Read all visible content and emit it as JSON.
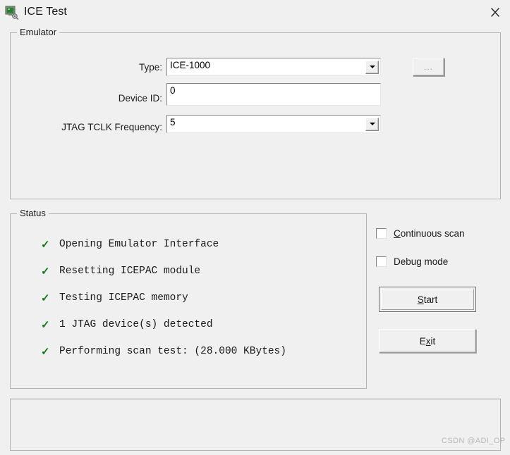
{
  "window": {
    "title": "ICE Test",
    "icon": "emulator-device-icon",
    "close_label": "✕"
  },
  "emulator": {
    "group_title": "Emulator",
    "type": {
      "label": "Type:",
      "value": "ICE-1000",
      "control": "combobox"
    },
    "device_id": {
      "label": "Device ID:",
      "value": "0",
      "placeholder": "",
      "control": "textbox"
    },
    "tclk": {
      "label": "JTAG TCLK Frequency:",
      "value": "5",
      "control": "combobox"
    },
    "browse_button": {
      "label": "...",
      "enabled": false
    }
  },
  "status": {
    "group_title": "Status",
    "check_glyph": "✓",
    "check_color": "#19781e",
    "items": [
      {
        "text": "Opening Emulator Interface",
        "done": true
      },
      {
        "text": "Resetting ICEPAC module",
        "done": true
      },
      {
        "text": "Testing ICEPAC memory",
        "done": true
      },
      {
        "text": "1 JTAG device(s) detected",
        "done": true
      },
      {
        "text": "Performing scan test: (28.000 KBytes)",
        "done": true
      }
    ]
  },
  "options": {
    "continuous_scan": {
      "label_accel": "C",
      "label_rest": "ontinuous scan",
      "checked": false
    },
    "debug_mode": {
      "label_accel": "D",
      "label_rest": "ebug mode",
      "checked": false
    }
  },
  "actions": {
    "start": {
      "accel": "S",
      "rest": "tart",
      "default": true
    },
    "exit": {
      "pre": "E",
      "accel": "x",
      "rest": "it",
      "default": false
    }
  },
  "watermark": {
    "text": "CSDN @ADI_OP"
  }
}
